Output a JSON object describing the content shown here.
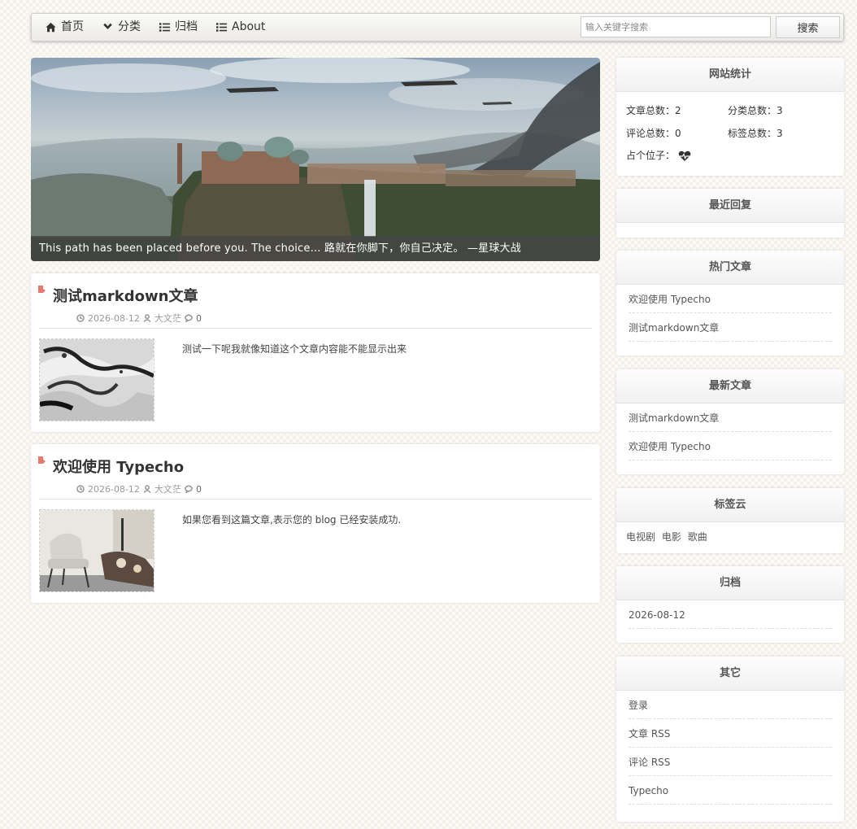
{
  "nav": {
    "items": [
      {
        "label": "首页",
        "icon": "home-icon"
      },
      {
        "label": "分类",
        "icon": "chevron-down-icon"
      },
      {
        "label": "归档",
        "icon": "list-icon"
      },
      {
        "label": "About",
        "icon": "list-icon"
      }
    ],
    "search_placeholder": "输入关键字搜索",
    "search_button": "搜索"
  },
  "hero": {
    "caption": "This path has been placed before you. The choice... 路就在你脚下，你自己决定。 —星球大战"
  },
  "posts": [
    {
      "title": "测试markdown文章",
      "date": "2026-08-12",
      "author": "大文茫",
      "comments": "0",
      "excerpt": "测试一下呢我就像知道这个文章内容能不能显示出来"
    },
    {
      "title": "欢迎使用 Typecho",
      "date": "2026-08-12",
      "author": "大文茫",
      "comments": "0",
      "excerpt": "如果您看到这篇文章,表示您的 blog 已经安装成功."
    }
  ],
  "sidebar": {
    "stats": {
      "title": "网站统计",
      "posts_label": "文章总数：",
      "posts_value": "2",
      "categories_label": "分类总数：",
      "categories_value": "3",
      "comments_label": "评论总数：",
      "comments_value": "0",
      "tags_label": "标签总数：",
      "tags_value": "3",
      "placeholder_label": "占个位子："
    },
    "recent_replies": {
      "title": "最近回复"
    },
    "hot_posts": {
      "title": "热门文章",
      "items": [
        "欢迎使用 Typecho",
        "测试markdown文章"
      ]
    },
    "latest_posts": {
      "title": "最新文章",
      "items": [
        "测试markdown文章",
        "欢迎使用 Typecho"
      ]
    },
    "tag_cloud": {
      "title": "标签云",
      "tags": [
        "电视剧",
        "电影",
        "歌曲"
      ]
    },
    "archive": {
      "title": "归档",
      "items": [
        "2026-08-12"
      ]
    },
    "other": {
      "title": "其它",
      "items": [
        "登录",
        "文章 RSS",
        "评论 RSS",
        "Typecho"
      ]
    }
  },
  "colors": {
    "accent_marker": "#e8776c",
    "page_background": "#f4f2ea"
  }
}
